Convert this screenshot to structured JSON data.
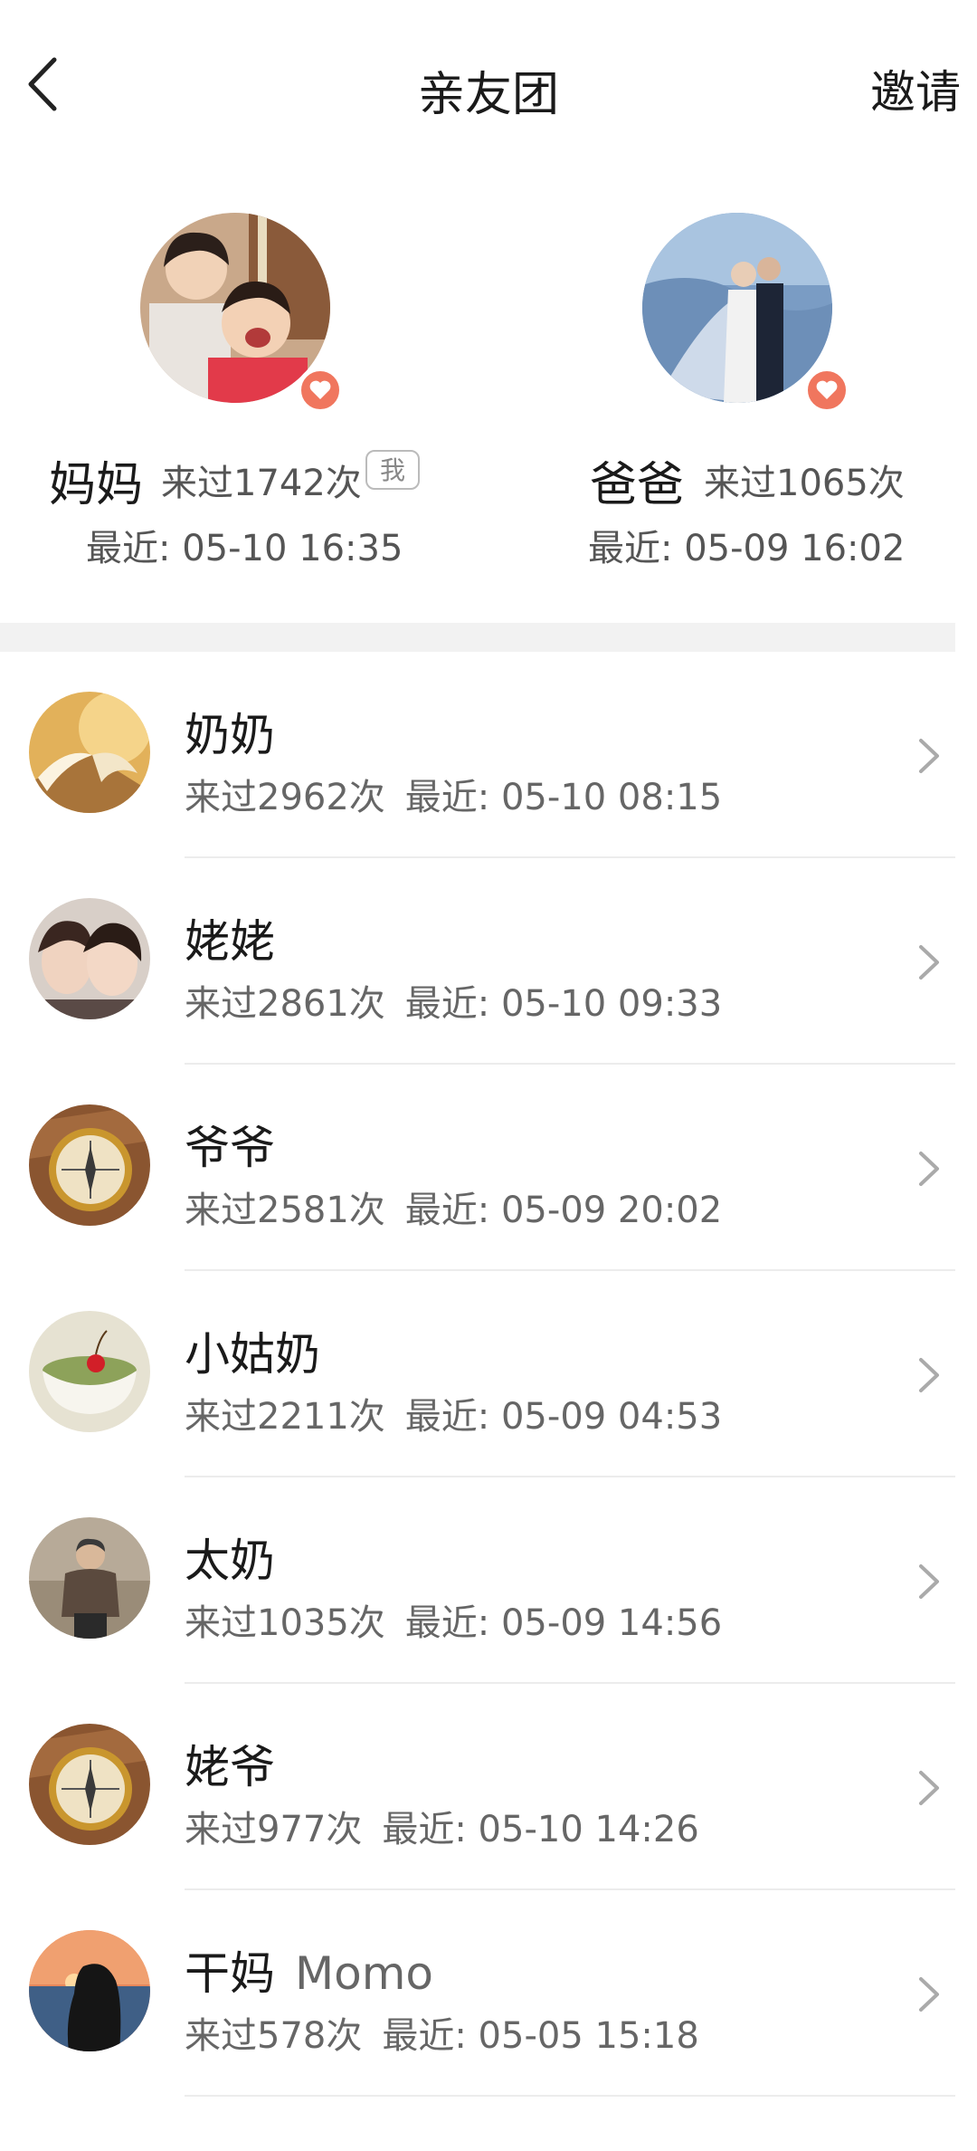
{
  "header": {
    "title": "亲友团",
    "invite_label": "邀请"
  },
  "parents": [
    {
      "name": "妈妈",
      "visits": "来过1742次",
      "me_badge": "我",
      "recent": "最近: 05-10 16:35"
    },
    {
      "name": "爸爸",
      "visits": "来过1065次",
      "recent": "最近: 05-09 16:02"
    }
  ],
  "relatives": [
    {
      "name": "奶奶",
      "alias": "",
      "visits": "来过2962次",
      "recent": "最近: 05-10 08:15",
      "avatar": "book"
    },
    {
      "name": "姥姥",
      "alias": "",
      "visits": "来过2861次",
      "recent": "最近: 05-10 09:33",
      "avatar": "selfie"
    },
    {
      "name": "爷爷",
      "alias": "",
      "visits": "来过2581次",
      "recent": "最近: 05-09 20:02",
      "avatar": "compass"
    },
    {
      "name": "小姑奶",
      "alias": "",
      "visits": "来过2211次",
      "recent": "最近: 05-09 04:53",
      "avatar": "dessert"
    },
    {
      "name": "太奶",
      "alias": "",
      "visits": "来过1035次",
      "recent": "最近: 05-09 14:56",
      "avatar": "elder"
    },
    {
      "name": "姥爷",
      "alias": "",
      "visits": "来过977次",
      "recent": "最近: 05-10 14:26",
      "avatar": "compass"
    },
    {
      "name": "干妈",
      "alias": "Momo",
      "visits": "来过578次",
      "recent": "最近: 05-05 15:18",
      "avatar": "sunset"
    }
  ],
  "colors": {
    "heart_badge": "#f0765e",
    "divider": "#f2f2f2",
    "secondary_text": "#666666"
  },
  "icons": {
    "back": "back-arrow-icon",
    "heart": "heart-icon",
    "chevron": "chevron-right-icon"
  }
}
